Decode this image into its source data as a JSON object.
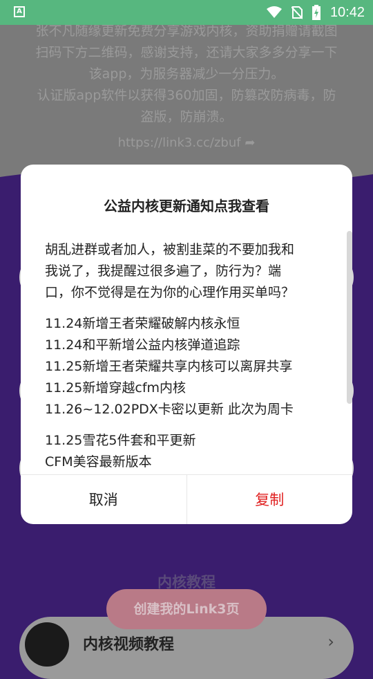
{
  "status_bar": {
    "time": "10:42",
    "app_icon_letter": "A"
  },
  "background": {
    "text_lines": [
      "张不凡随缘更新免费分享游戏内核，资助捐赠请截图",
      "扫码下方二维码，感谢支持，还请大家多多分享一下",
      "该app，为服务器减少一分压力。",
      "认证版app软件以获得360加固，防篡改防病毒，防",
      "盗版，防崩溃。"
    ],
    "link": "https://link3.cc/zbuf",
    "section_title": "内核教程",
    "create_button": "创建我的Link3页",
    "video_row_label": "内核视频教程"
  },
  "dialog": {
    "title": "公益内核更新通知点我查看",
    "intro_lines": [
      "胡乱进群或者加人，被割韭菜的不要加我和",
      "我说了，我提醒过很多遍了，防行为？端",
      "口，你不觉得是在为你的心理作用买单吗？"
    ],
    "updates": [
      "11.24新增王者荣耀破解内核永恒",
      "11.24和平新增公益内核弹道追踪",
      "11.25新增王者荣耀共享内核可以离屏共享",
      "11.25新增穿越cfm内核",
      "11.26~12.02PDX卡密以更新 此次为周卡"
    ],
    "updates2": [
      "11.25雪花5件套和平更新",
      "CFM美容最新版本"
    ],
    "cancel_label": "取消",
    "copy_label": "复制"
  },
  "colors": {
    "status_bar": "#57b77f",
    "accent_red": "#e02020",
    "page_bg": "#3a1d6e"
  }
}
